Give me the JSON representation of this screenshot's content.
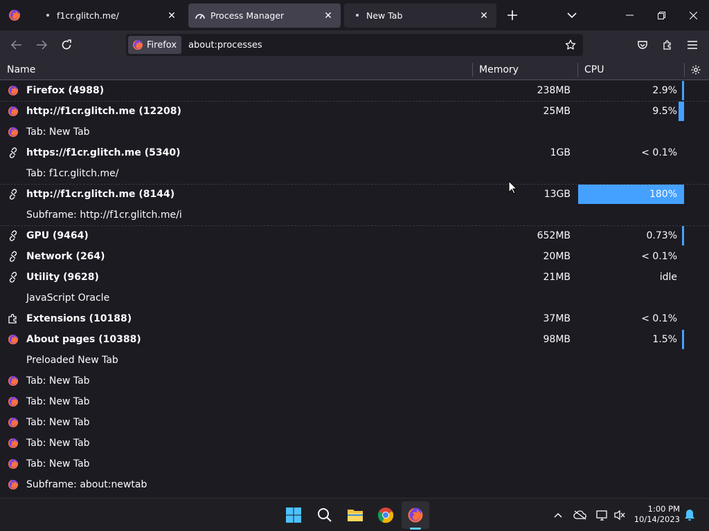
{
  "tabs": [
    {
      "label": "f1cr.glitch.me/",
      "active": false
    },
    {
      "label": "Process Manager",
      "active": true
    },
    {
      "label": "New Tab",
      "active": false
    }
  ],
  "navbar": {
    "identity_label": "Firefox",
    "url": "about:processes"
  },
  "table": {
    "columns": {
      "name": "Name",
      "memory": "Memory",
      "cpu": "CPU"
    },
    "rows": [
      {
        "icon": "firefox-icon",
        "name": "Firefox (4988)",
        "memory": "238MB",
        "cpu": "2.9%",
        "bold": true,
        "cpu_load": 0.016
      },
      {
        "icon": "firefox-icon",
        "name": "http://f1cr.glitch.me (12208)",
        "memory": "25MB",
        "cpu": "9.5%",
        "bold": true,
        "cpu_load": 0.053
      },
      {
        "icon": "firefox-icon",
        "name": "Tab: New Tab",
        "memory": "",
        "cpu": "",
        "bold": false
      },
      {
        "icon": "puzzle-link-icon",
        "name": "https://f1cr.glitch.me (5340)",
        "memory": "1GB",
        "cpu": "< 0.1%",
        "bold": true
      },
      {
        "icon": "",
        "name": "Tab: f1cr.glitch.me/",
        "memory": "",
        "cpu": "",
        "bold": false
      },
      {
        "icon": "puzzle-link-icon",
        "name": "http://f1cr.glitch.me (8144)",
        "memory": "13GB",
        "cpu": "180%",
        "bold": true,
        "cpu_load": 1.0
      },
      {
        "icon": "",
        "name": "Subframe: http://f1cr.glitch.me/i",
        "memory": "",
        "cpu": "",
        "bold": false
      },
      {
        "icon": "puzzle-link-icon",
        "name": "GPU (9464)",
        "memory": "652MB",
        "cpu": "0.73%",
        "bold": true,
        "cpu_load": 0.004
      },
      {
        "icon": "puzzle-link-icon",
        "name": "Network (264)",
        "memory": "20MB",
        "cpu": "< 0.1%",
        "bold": true
      },
      {
        "icon": "puzzle-link-icon",
        "name": "Utility (9628)",
        "memory": "21MB",
        "cpu": "idle",
        "bold": true
      },
      {
        "icon": "",
        "name": "JavaScript Oracle",
        "memory": "",
        "cpu": "",
        "bold": false
      },
      {
        "icon": "extension-icon",
        "name": "Extensions (10188)",
        "memory": "37MB",
        "cpu": "< 0.1%",
        "bold": true
      },
      {
        "icon": "firefox-icon",
        "name": "About pages (10388)",
        "memory": "98MB",
        "cpu": "1.5%",
        "bold": true,
        "cpu_load": 0.008
      },
      {
        "icon": "",
        "name": "Preloaded New Tab",
        "memory": "",
        "cpu": "",
        "bold": false
      },
      {
        "icon": "firefox-icon",
        "name": "Tab: New Tab",
        "memory": "",
        "cpu": "",
        "bold": false
      },
      {
        "icon": "firefox-icon",
        "name": "Tab: New Tab",
        "memory": "",
        "cpu": "",
        "bold": false
      },
      {
        "icon": "firefox-icon",
        "name": "Tab: New Tab",
        "memory": "",
        "cpu": "",
        "bold": false
      },
      {
        "icon": "firefox-icon",
        "name": "Tab: New Tab",
        "memory": "",
        "cpu": "",
        "bold": false
      },
      {
        "icon": "firefox-icon",
        "name": "Tab: New Tab",
        "memory": "",
        "cpu": "",
        "bold": false
      },
      {
        "icon": "firefox-icon",
        "name": "Subframe: about:newtab",
        "memory": "",
        "cpu": "",
        "bold": false
      }
    ]
  },
  "taskbar": {
    "apps": [
      "windows-start-icon",
      "search-icon",
      "file-explorer-icon",
      "chrome-icon",
      "firefox-icon"
    ],
    "clock_time": "1:00 PM",
    "clock_date": "10/14/2023"
  },
  "colors": {
    "accent": "#45a1ff",
    "background": "#1c1b22",
    "toolbar": "#2b2a33"
  }
}
